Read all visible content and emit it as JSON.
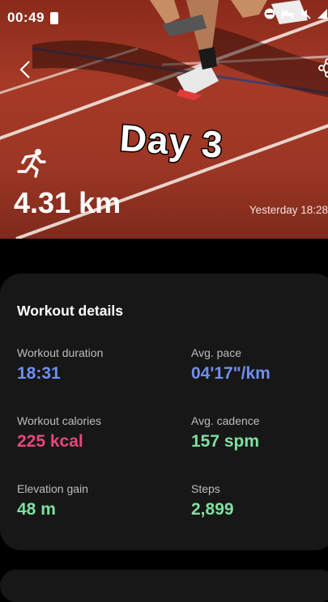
{
  "status_bar": {
    "time": "00:49",
    "icons": [
      "battery-alert-icon",
      "do-not-disturb-icon",
      "bed-icon",
      "mute-icon",
      "signal-icon"
    ]
  },
  "hero": {
    "overlay_title": "Day 3",
    "distance": "4.31 km",
    "timestamp": "Yesterday 18:28",
    "activity_icon": "running-icon"
  },
  "details": {
    "title": "Workout details",
    "metrics": [
      {
        "label": "Workout duration",
        "value": "18:31",
        "color": "#6f8ff0"
      },
      {
        "label": "Avg. pace",
        "value": "04'17\"/km",
        "color": "#6f8ff0"
      },
      {
        "label": "Workout calories",
        "value": "225 kcal",
        "color": "#e8467f"
      },
      {
        "label": "Avg. cadence",
        "value": "157 spm",
        "color": "#7ee0a1"
      },
      {
        "label": "Elevation gain",
        "value": "48 m",
        "color": "#7ee0a1"
      },
      {
        "label": "Steps",
        "value": "2,899",
        "color": "#7ee0a1"
      }
    ]
  }
}
